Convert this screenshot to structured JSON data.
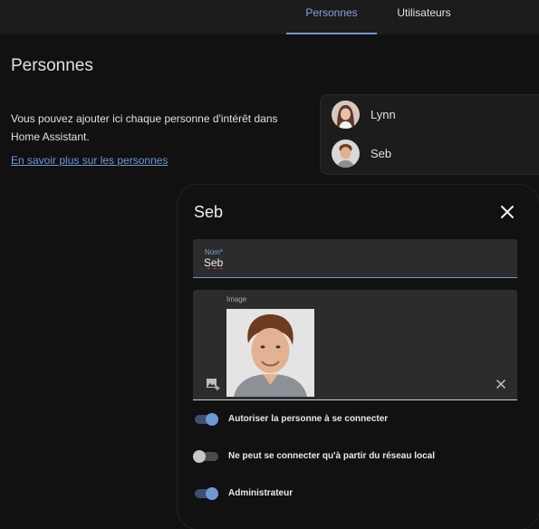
{
  "tabs": [
    {
      "label": "Personnes",
      "active": true
    },
    {
      "label": "Utilisateurs",
      "active": false
    }
  ],
  "page": {
    "title": "Personnes",
    "intro": "Vous pouvez ajouter ici chaque personne d'intérêt dans Home Assistant.",
    "learn_more": "En savoir plus sur les personnes"
  },
  "people": [
    {
      "name": "Lynn"
    },
    {
      "name": "Seb"
    }
  ],
  "dialog": {
    "title": "Seb",
    "name_field": {
      "label": "Nom*",
      "value": "Seb"
    },
    "image_field": {
      "label": "Image"
    },
    "toggles": [
      {
        "label": "Autoriser la personne à se connecter",
        "on": true
      },
      {
        "label": "Ne peut se connecter qu'à partir du réseau local",
        "on": false
      },
      {
        "label": "Administrateur",
        "on": true
      }
    ]
  },
  "colors": {
    "accent": "#6f97d6",
    "background": "#111111",
    "surface": "#1c1c1c"
  }
}
